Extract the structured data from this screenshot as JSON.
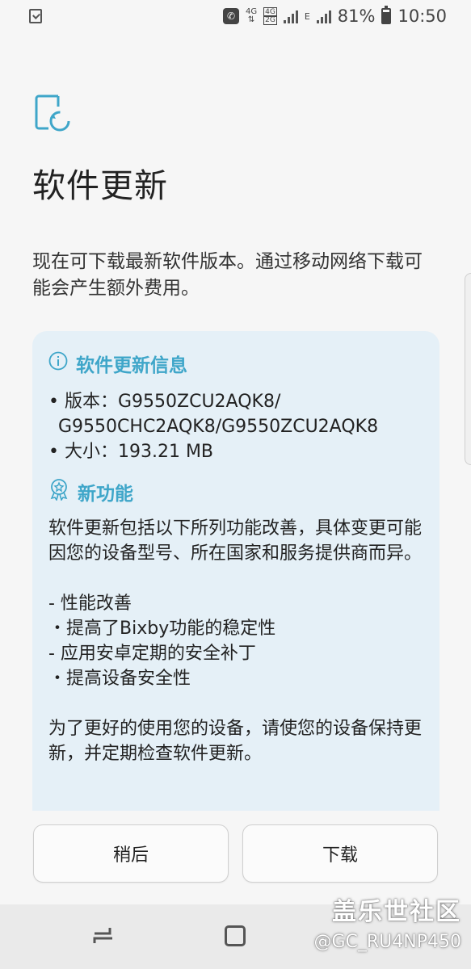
{
  "status_bar": {
    "battery": "81%",
    "time": "10:50",
    "net_top": "4G",
    "net_box_top": "4G",
    "net_box_bottom": "2G",
    "net_e": "E"
  },
  "header": {
    "title": "软件更新"
  },
  "description": "现在可下载最新软件版本。通过移动网络下载可能会产生额外费用。",
  "info": {
    "section_title": "软件更新信息",
    "version_line1": "• 版本：G9550ZCU2AQK8/",
    "version_line2": "G9550CHC2AQK8/G9550ZCU2AQK8",
    "size_line": "• 大小：193.21 MB"
  },
  "features": {
    "section_title": "新功能",
    "body": "软件更新包括以下所列功能改善，具体变更可能因您的设备型号、所在国家和服务提供商而异。\n\n- 性能改善\n ・提高了Bixby功能的稳定性\n- 应用安卓定期的安全补丁\n ・提高设备安全性\n\n为了更好的使用您的设备，请使您的设备保持更新，并定期检查软件更新。"
  },
  "buttons": {
    "later": "稍后",
    "download": "下载"
  },
  "watermark": {
    "brand": "盖乐世社区",
    "user": "@GC_RU4NP450"
  },
  "colors": {
    "accent": "#3fa6c9",
    "card_bg": "#e5f0f7"
  }
}
